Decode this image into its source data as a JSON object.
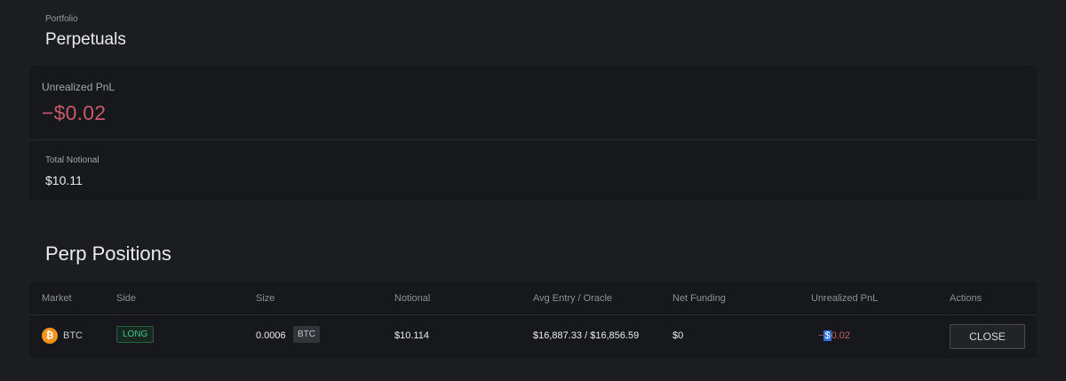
{
  "breadcrumb": "Portfolio",
  "page_title": "Perpetuals",
  "summary": {
    "unrealized_pnl_label": "Unrealized PnL",
    "unrealized_pnl_value": "−$0.02",
    "total_notional_label": "Total Notional",
    "total_notional_value": "$10.11"
  },
  "positions": {
    "title": "Perp Positions",
    "columns": [
      "Market",
      "Side",
      "Size",
      "Notional",
      "Avg Entry / Oracle",
      "Net Funding",
      "Unrealized PnL",
      "Actions"
    ],
    "rows": [
      {
        "market": "BTC",
        "coin_icon": "bitcoin-icon",
        "coin_symbol": "₿",
        "side": "LONG",
        "size": "0.0006",
        "size_unit": "BTC",
        "notional": "$10.114",
        "avg_entry_oracle": "$16,887.33 / $16,856.59",
        "net_funding": "$0",
        "pnl_minus": "−",
        "pnl_dollar": "$",
        "pnl_rest": "0.02",
        "action": "CLOSE"
      }
    ]
  },
  "colors": {
    "background": "#1c1d21",
    "panel": "#17181b",
    "negative": "#c55a6b",
    "long_green": "#43c28a",
    "btc_orange": "#f7931a",
    "selection_blue": "#2f6fe0"
  }
}
